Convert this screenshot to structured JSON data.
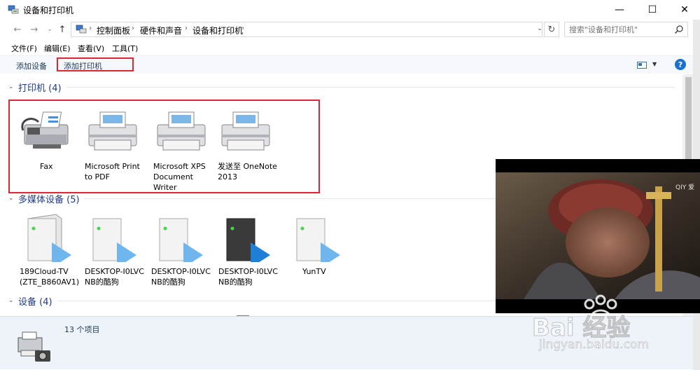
{
  "window": {
    "title": "设备和打印机",
    "minimize_glyph": "—",
    "maximize_glyph": "☐",
    "close_glyph": "✕"
  },
  "address": {
    "crumbs": [
      "控制面板",
      "硬件和声音",
      "设备和打印机"
    ],
    "search_placeholder": "搜索\"设备和打印机\""
  },
  "menu": {
    "items": [
      "文件(F)",
      "编辑(E)",
      "查看(V)",
      "工具(T)"
    ]
  },
  "toolbar": {
    "add_device": "添加设备",
    "add_printer": "添加打印机",
    "help": "?"
  },
  "groups": {
    "printers": {
      "label": "打印机 (4)",
      "items": [
        {
          "lines": [
            "Fax"
          ]
        },
        {
          "lines": [
            "Microsoft Print",
            "to PDF"
          ]
        },
        {
          "lines": [
            "Microsoft XPS",
            "Document",
            "Writer"
          ]
        },
        {
          "lines": [
            "发送至 OneNote",
            "2013"
          ]
        }
      ]
    },
    "media": {
      "label": "多媒体设备 (5)",
      "items": [
        {
          "lines": [
            "189Cloud-TV",
            "(ZTE_B860AV1)"
          ]
        },
        {
          "lines": [
            "DESKTOP-I0LVC",
            "NB的酷狗"
          ]
        },
        {
          "lines": [
            "DESKTOP-I0LVC",
            "NB的酷狗"
          ]
        },
        {
          "lines": [
            "DESKTOP-I0LVC",
            "NB的酷狗"
          ]
        },
        {
          "lines": [
            "YunTV"
          ]
        }
      ]
    },
    "devices": {
      "label": "设备 (4)"
    }
  },
  "details": {
    "count": "13 个项目"
  },
  "overlay": {
    "video_logo": "QIY 爱",
    "watermark_brand": "Bai 经验",
    "watermark_url": "jingyan.baidu.com"
  },
  "colors": {
    "accent_red": "#e0272f",
    "group_header": "#1e3a8a",
    "toolbar_bg": "#f5f8fc",
    "details_bg": "#eef3fa"
  }
}
